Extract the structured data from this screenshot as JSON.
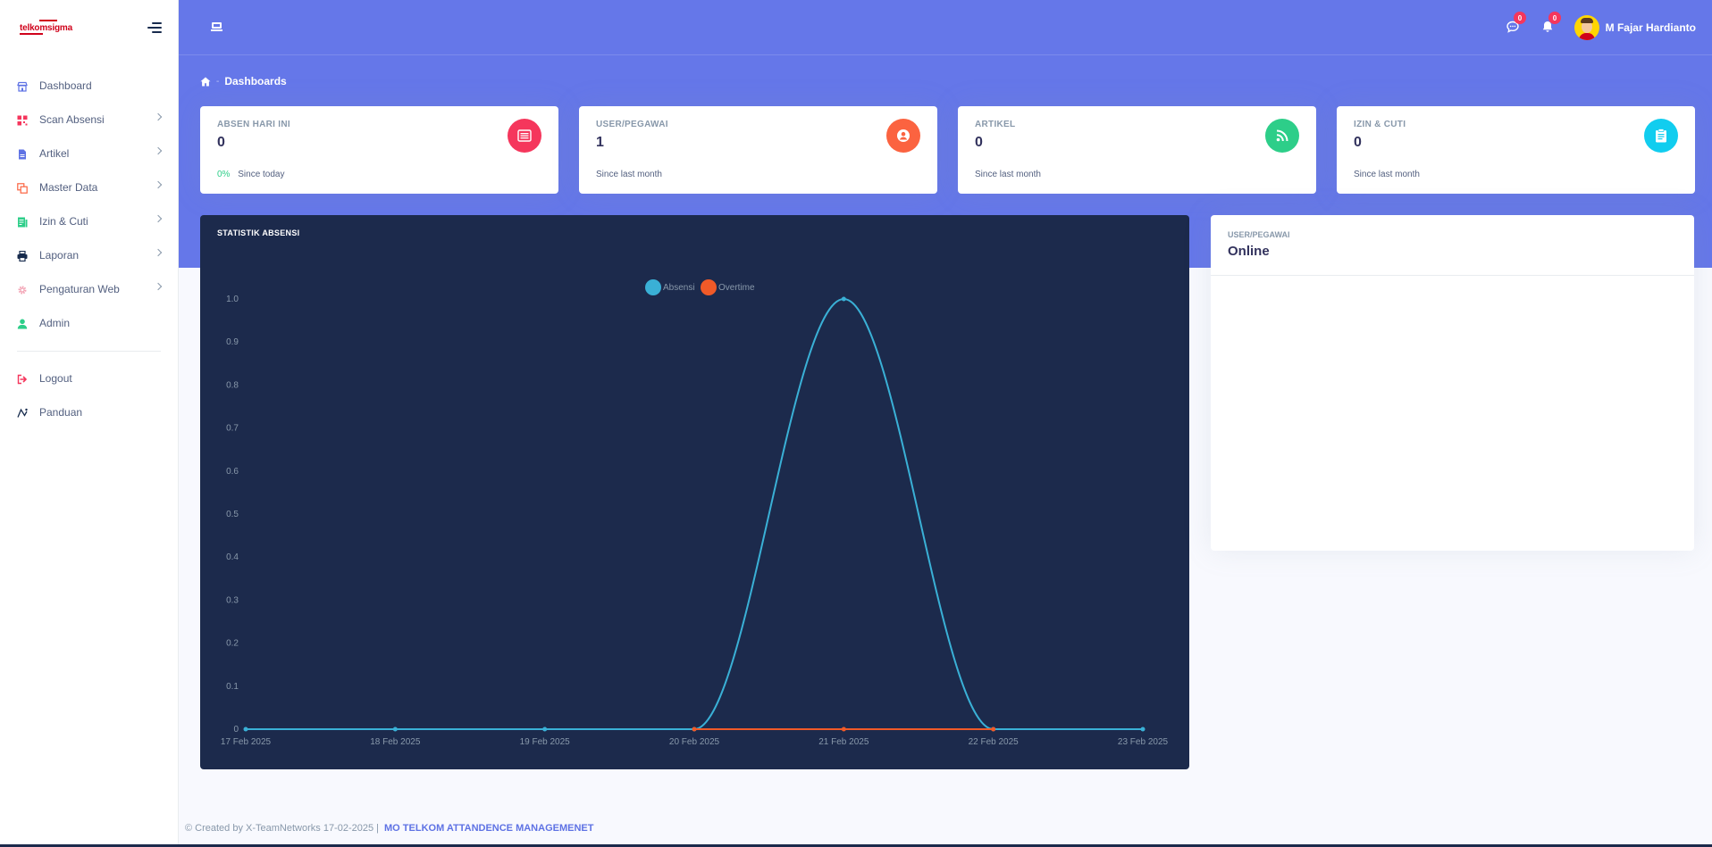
{
  "sidebar": {
    "logo_text": "telkomsigma",
    "items": [
      {
        "label": "Dashboard",
        "icon": "shop-icon",
        "color": "#5e72e4",
        "chevron": false
      },
      {
        "label": "Scan Absensi",
        "icon": "qr-code-icon",
        "color": "#f5365c",
        "chevron": true
      },
      {
        "label": "Artikel",
        "icon": "document-icon",
        "color": "#5e72e4",
        "chevron": true
      },
      {
        "label": "Master Data",
        "icon": "copy-icon",
        "color": "#fb6340",
        "chevron": true
      },
      {
        "label": "Izin & Cuti",
        "icon": "notes-icon",
        "color": "#2dce89",
        "chevron": true
      },
      {
        "label": "Laporan",
        "icon": "printer-icon",
        "color": "#172b4d",
        "chevron": true
      },
      {
        "label": "Pengaturan Web",
        "icon": "settings-icon",
        "color": "#f3a4b5",
        "chevron": true
      },
      {
        "label": "Admin",
        "icon": "user-icon",
        "color": "#2dce89",
        "chevron": false
      }
    ],
    "bottom_items": [
      {
        "label": "Logout",
        "icon": "logout-icon",
        "color": "#f5365c"
      },
      {
        "label": "Panduan",
        "icon": "guide-icon",
        "color": "#172b4d"
      }
    ]
  },
  "topbar": {
    "chat_badge": "0",
    "notif_badge": "0",
    "user_name": "M Fajar Hardianto"
  },
  "breadcrumb": {
    "current": "Dashboards"
  },
  "cards": [
    {
      "title": "ABSEN HARI INI",
      "value": "0",
      "pct": "0%",
      "foot": "Since today",
      "icon": "list-icon",
      "color": "#f5365c"
    },
    {
      "title": "USER/PEGAWAI",
      "value": "1",
      "pct": "",
      "foot": "Since last month",
      "icon": "user-circle-icon",
      "color": "#fb6340"
    },
    {
      "title": "ARTIKEL",
      "value": "0",
      "pct": "",
      "foot": "Since last month",
      "icon": "rss-icon",
      "color": "#2dce89"
    },
    {
      "title": "IZIN & CUTI",
      "value": "0",
      "pct": "",
      "foot": "Since last month",
      "icon": "clipboard-icon",
      "color": "#11cdef"
    }
  ],
  "chart_panel": {
    "title": "STATISTIK ABSENSI"
  },
  "chart_data": {
    "type": "line",
    "x": [
      "17 Feb 2025",
      "18 Feb 2025",
      "19 Feb 2025",
      "20 Feb 2025",
      "21 Feb 2025",
      "22 Feb 2025",
      "23 Feb 2025"
    ],
    "series": [
      {
        "name": "Absensi",
        "color": "#3ab0d6",
        "values": [
          0,
          0,
          0,
          0,
          1,
          0,
          0
        ]
      },
      {
        "name": "Overtime",
        "color": "#f05a28",
        "values": [
          null,
          null,
          null,
          0,
          0,
          0,
          null
        ]
      }
    ],
    "ylim": [
      0,
      1.0
    ],
    "yticks": [
      "0",
      "0.1",
      "0.2",
      "0.3",
      "0.4",
      "0.5",
      "0.6",
      "0.7",
      "0.8",
      "0.9",
      "1.0"
    ],
    "legend": "top-center",
    "grid": false
  },
  "online_panel": {
    "subtitle": "USER/PEGAWAI",
    "title": "Online"
  },
  "footer": {
    "created": "© Created by X-TeamNetworks 17-02-2025 |",
    "brand": "MO TELKOM ATTANDENCE MANAGEMENET"
  }
}
